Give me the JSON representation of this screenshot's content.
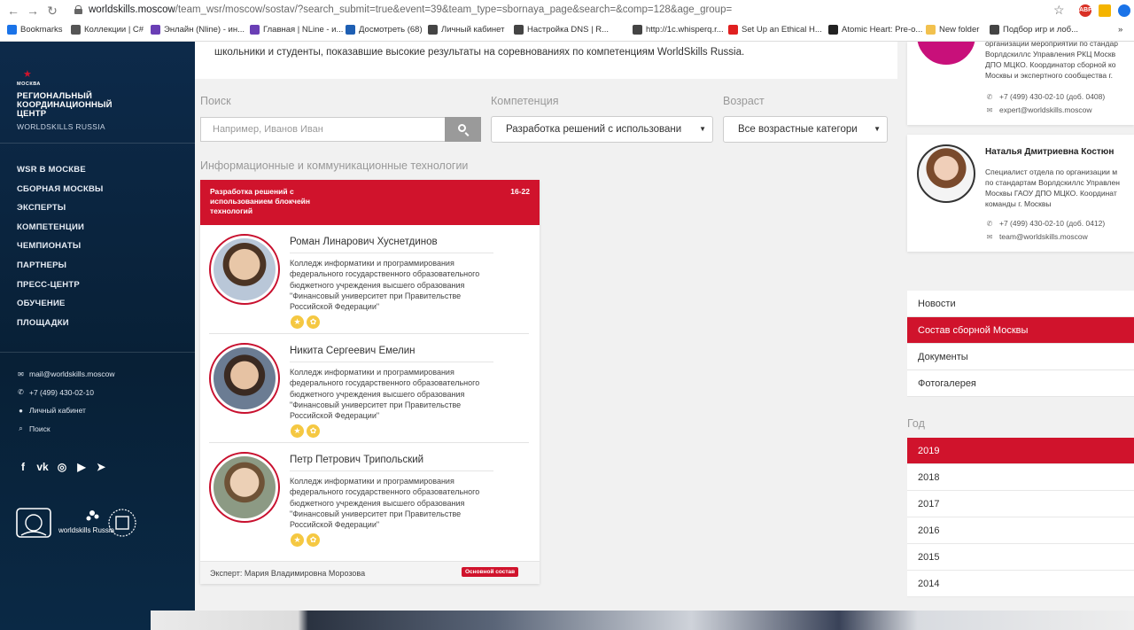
{
  "browser": {
    "url_host": "worldskills.moscow",
    "url_path": "/team_wsr/moscow/sostav/?search_submit=true&event=39&team_type=sbornaya_page&search=&comp=128&age_group=",
    "bookmarks": [
      {
        "label": "Bookmarks",
        "color": "#1a73e8"
      },
      {
        "label": "Коллекции | C#",
        "color": "#555555"
      },
      {
        "label": "Энлайн (Nline) - ин...",
        "color": "#6a3fb5"
      },
      {
        "label": "Главная | NLine - и...",
        "color": "#6a3fb5"
      },
      {
        "label": "Досмотреть (68)",
        "color": "#1e5fb3"
      },
      {
        "label": "Личный кабинет",
        "color": "#444444"
      },
      {
        "label": "Настройка DNS | R...",
        "color": "#444444"
      },
      {
        "label": "http://1c.whisperq.r...",
        "color": "#444444"
      },
      {
        "label": "Set Up an Ethical H...",
        "color": "#e02020"
      },
      {
        "label": "Atomic Heart: Pre-o...",
        "color": "#222222"
      },
      {
        "label": "New folder",
        "color": "#f2c14e"
      },
      {
        "label": "Подбор игр и лоб...",
        "color": "#444444"
      }
    ],
    "bookmarks_more": "»"
  },
  "sidebar": {
    "city_caption": "МОСКВА",
    "org_name": "РЕГИОНАЛЬНЫЙ КООРДИНАЦИОННЫЙ ЦЕНТР",
    "org_sub": "WORLDSKILLS RUSSIA",
    "nav": [
      "WSR В МОСКВЕ",
      "СБОРНАЯ МОСКВЫ",
      "ЭКСПЕРТЫ",
      "КОМПЕТЕНЦИИ",
      "ЧЕМПИОНАТЫ",
      "ПАРТНЕРЫ",
      "ПРЕСС-ЦЕНТР",
      "ОБУЧЕНИЕ",
      "ПЛОЩАДКИ"
    ],
    "contacts": {
      "email": "mail@worldskills.moscow",
      "phone": "+7 (499) 430-02-10",
      "cabinet": "Личный кабинет",
      "search": "Поиск"
    },
    "logo_text": "worldskills Russia"
  },
  "intro": {
    "text": "школьники и студенты, показавшие высокие результаты на соревнованиях по компетенциям WorldSkills Russia."
  },
  "filters": {
    "search_label": "Поиск",
    "search_placeholder": "Например, Иванов Иван",
    "competence_label": "Компетенция",
    "competence_value": "Разработка решений с использовани",
    "age_label": "Возраст",
    "age_value": "Все возрастные категори"
  },
  "category": "Информационные и коммуникационные технологии",
  "team": {
    "name": "Разработка решений с использованием блокчейн технологий",
    "age": "16-22",
    "members": [
      {
        "name": "Роман Линарович Хуснетдинов",
        "institution": "Колледж информатики и программирования федерального государственного образовательного бюджетного учреждения высшего образования \"Финансовый университет при Правительстве Российской Федерации\""
      },
      {
        "name": "Никита Сергеевич Емелин",
        "institution": "Колледж информатики и программирования федерального государственного образовательного бюджетного учреждения высшего образования \"Финансовый университет при Правительстве Российской Федерации\""
      },
      {
        "name": "Петр Петрович Трипольский",
        "institution": "Колледж информатики и программирования федерального государственного образовательного бюджетного учреждения высшего образования \"Финансовый университет при Правительстве Российской Федерации\""
      }
    ],
    "expert": "Эксперт: Мария Владимировна Морозова",
    "badge": "Основной состав"
  },
  "contacts_right": [
    {
      "name": "",
      "desc": [
        "организации мероприятий по стандар",
        "Ворлдскиллс Управления РКЦ Москв",
        "ДПО МЦКО. Координатор сборной ко",
        "Москвы и экспертного сообщества г."
      ],
      "phone": "+7 (499) 430-02-10 (доб. 0408)",
      "email": "expert@worldskills.moscow"
    },
    {
      "name": "Наталья Дмитриевна Костюн",
      "desc": [
        "Специалист отдела по организации м",
        "по стандартам Ворлдскиллс Управлен",
        "Москвы ГАОУ ДПО МЦКО. Координат",
        "команды г. Москвы"
      ],
      "phone": "+7 (499) 430-02-10 (доб. 0412)",
      "email": "team@worldskills.moscow"
    }
  ],
  "menu": [
    "Новости",
    "Состав сборной Москвы",
    "Документы",
    "Фотогалерея"
  ],
  "year_label": "Год",
  "years": [
    "2019",
    "2018",
    "2017",
    "2016",
    "2015",
    "2014"
  ],
  "colors": {
    "accent": "#d0132c",
    "sidebar": "#0d2a4a"
  }
}
